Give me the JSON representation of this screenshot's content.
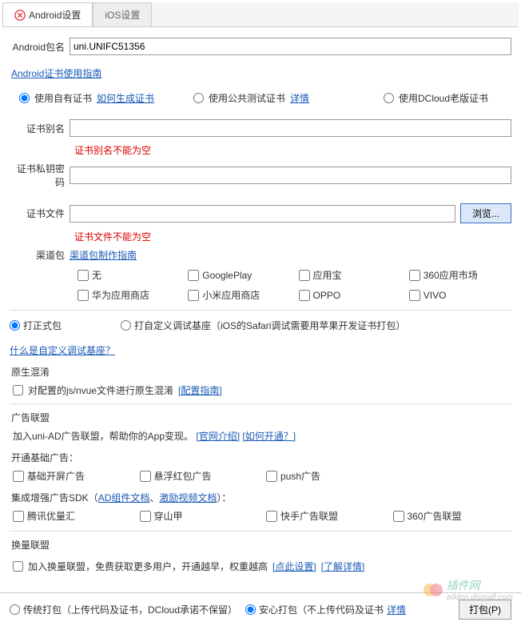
{
  "tabs": {
    "android": "Android设置",
    "ios": "iOS设置"
  },
  "package": {
    "label": "Android包名",
    "value": "uni.UNIFC51356"
  },
  "certGuide": "Android证书使用指南",
  "certRadio": {
    "own": "使用自有证书",
    "ownLink": "如何生成证书",
    "pub": "使用公共测试证书",
    "pubLink": "详情",
    "dcloud": "使用DCloud老版证书"
  },
  "cert": {
    "aliasLabel": "证书别名",
    "aliasErr": "证书别名不能为空",
    "pwLabel": "证书私钥密码",
    "fileLabel": "证书文件",
    "fileErr": "证书文件不能为空",
    "browse": "浏览...",
    "channelLabel": "渠道包",
    "channelLink": "渠道包制作指南"
  },
  "channels": [
    "无",
    "GooglePlay",
    "应用宝",
    "360应用市场",
    "华为应用商店",
    "小米应用商店",
    "OPPO",
    "VIVO"
  ],
  "buildType": {
    "release": "打正式包",
    "custom": "打自定义调试基座（iOS的Safari调试需要用苹果开发证书打包）",
    "customLink": "什么是自定义调试基座？"
  },
  "native": {
    "title": "原生混淆",
    "cb": "对配置的js/nvue文件进行原生混淆",
    "link": "[配置指南]"
  },
  "ads": {
    "title": "广告联盟",
    "intro": "加入uni-AD广告联盟，帮助你的App变现。",
    "introLink1": "[官网介绍]",
    "introLink2": "[如何开通？]",
    "basicTitle": "开通基础广告：",
    "basic": [
      "基础开屏广告",
      "悬浮红包广告",
      "push广告"
    ],
    "sdkTitle1": "集成增强广告SDK（",
    "sdkLink1": "AD组件文档",
    "sdkSep": "、",
    "sdkLink2": "激励视频文档",
    "sdkTitle2": "）：",
    "enhanced": [
      "腾讯优量汇",
      "穿山甲",
      "快手广告联盟",
      "360广告联盟"
    ]
  },
  "exchange": {
    "title": "换量联盟",
    "cb": "加入换量联盟，免费获取更多用户，开通越早，权重越高",
    "link1": "[点此设置]",
    "link2": "[了解详情]"
  },
  "footer": {
    "trad": "传统打包（上传代码及证书，DCloud承诺不保留）",
    "safe": "安心打包（不上传代码及证书",
    "safeLink": "详情",
    "btn": "打包(P)"
  },
  "watermark": {
    "main": "插件网",
    "sub": "addon.dismall.com"
  }
}
